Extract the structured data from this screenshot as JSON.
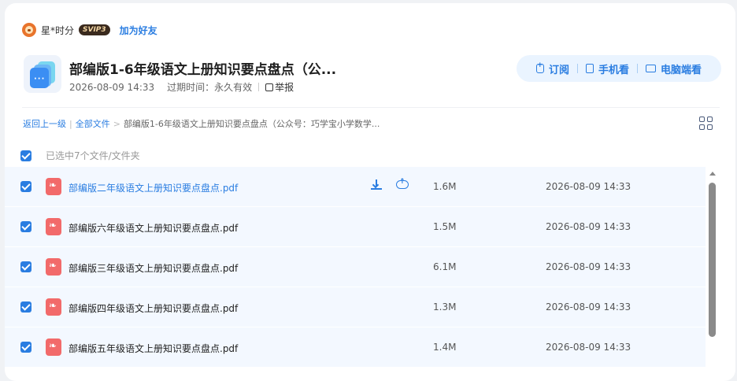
{
  "user": {
    "name": "星*时分",
    "vip_badge": "SVIP3",
    "add_friend": "加为好友"
  },
  "share": {
    "title": "部编版1-6年级语文上册知识要点盘点（公...",
    "date": "2026-08-09 14:33",
    "expiry": "过期时间：永久有效",
    "report": "举报"
  },
  "actions": [
    {
      "label": "订阅",
      "icon": "subscribe-icon"
    },
    {
      "label": "手机看",
      "icon": "phone-icon"
    },
    {
      "label": "电脑端看",
      "icon": "monitor-icon"
    }
  ],
  "breadcrumb": {
    "back": "返回上一级",
    "all_files": "全部文件",
    "current": "部编版1-6年级语文上册知识要点盘点（公众号：巧学宝小学数学..."
  },
  "selection": {
    "text": "已选中7个文件/文件夹"
  },
  "files": [
    {
      "name": "部编版二年级语文上册知识要点盘点.pdf",
      "size": "1.6M",
      "date": "2026-08-09 14:33"
    },
    {
      "name": "部编版六年级语文上册知识要点盘点.pdf",
      "size": "1.5M",
      "date": "2026-08-09 14:33"
    },
    {
      "name": "部编版三年级语文上册知识要点盘点.pdf",
      "size": "6.1M",
      "date": "2026-08-09 14:33"
    },
    {
      "name": "部编版四年级语文上册知识要点盘点.pdf",
      "size": "1.3M",
      "date": "2026-08-09 14:33"
    },
    {
      "name": "部编版五年级语文上册知识要点盘点.pdf",
      "size": "1.4M",
      "date": "2026-08-09 14:33"
    }
  ],
  "colors": {
    "accent": "#2a7de1",
    "row_bg": "#f3f8ff",
    "pdf_red": "#f26a6a"
  }
}
